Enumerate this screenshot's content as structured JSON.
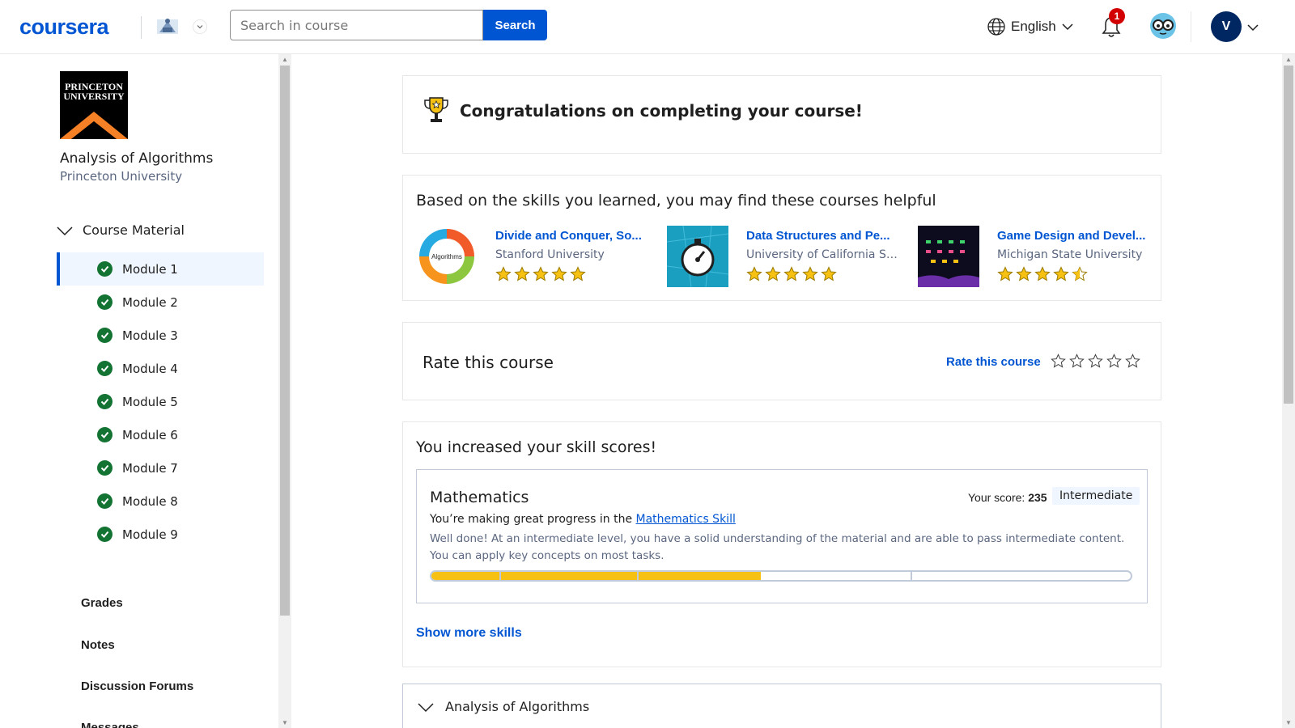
{
  "header": {
    "logo_text": "coursera",
    "search_placeholder": "Search in course",
    "search_button": "Search",
    "language": "English",
    "notification_count": "1",
    "avatar_initial": "V"
  },
  "sidebar": {
    "logo_text": "PRINCETON UNIVERSITY",
    "course_title": "Analysis of Algorithms",
    "course_university": "Princeton University",
    "course_material_label": "Course Material",
    "modules": [
      {
        "label": "Module 1",
        "completed": true,
        "active": true
      },
      {
        "label": "Module 2",
        "completed": true,
        "active": false
      },
      {
        "label": "Module 3",
        "completed": true,
        "active": false
      },
      {
        "label": "Module 4",
        "completed": true,
        "active": false
      },
      {
        "label": "Module 5",
        "completed": true,
        "active": false
      },
      {
        "label": "Module 6",
        "completed": true,
        "active": false
      },
      {
        "label": "Module 7",
        "completed": true,
        "active": false
      },
      {
        "label": "Module 8",
        "completed": true,
        "active": false
      },
      {
        "label": "Module 9",
        "completed": true,
        "active": false
      }
    ],
    "links": [
      "Grades",
      "Notes",
      "Discussion Forums",
      "Messages"
    ]
  },
  "main": {
    "congrats_title": "Congratulations on completing your course!",
    "reco_heading": "Based on the skills you learned, you may find these courses helpful",
    "recommendations": [
      {
        "name": "Divide and Conquer, So...",
        "partner": "Stanford University",
        "rating": 5,
        "thumb_label": "Algorithms"
      },
      {
        "name": "Data Structures and Pe...",
        "partner": "University of California San...",
        "rating": 5,
        "thumb_label": ""
      },
      {
        "name": "Game Design and Devel...",
        "partner": "Michigan State University",
        "rating": 4.5,
        "thumb_label": ""
      }
    ],
    "rate_label": "Rate this course",
    "rate_link": "Rate this course",
    "skills_heading": "You increased your skill scores!",
    "skill": {
      "name": "Mathematics",
      "score_label": "Your score:",
      "score": "235",
      "level": "Intermediate",
      "progress_prefix": "You’re making great progress in the",
      "progress_link": "Mathematics Skill",
      "description": "Well done! At an intermediate level, you have a solid understanding of the material and are able to pass intermediate content. You can apply key concepts on most tasks.",
      "segments": [
        {
          "fill": 1.0
        },
        {
          "fill": 1.0
        },
        {
          "fill": 0.45
        },
        {
          "fill": 0.0
        }
      ]
    },
    "show_more_skills": "Show more skills",
    "accordion_title": "Analysis of Algorithms"
  },
  "colors": {
    "brand": "#0056d2",
    "check_green": "#137333",
    "star_gold": "#f7c113",
    "badge_red": "#d30001"
  }
}
